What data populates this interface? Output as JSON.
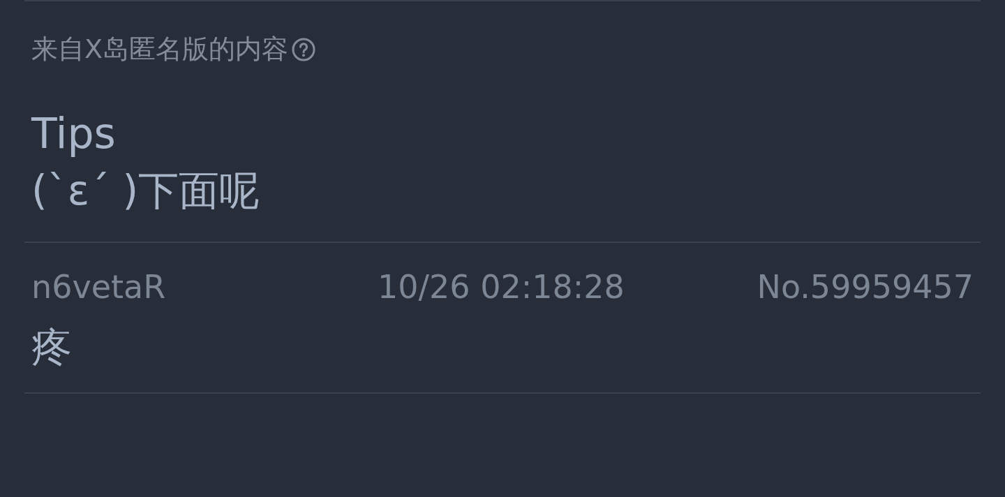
{
  "source_note": {
    "text": "来自X岛匿名版的内容"
  },
  "post": {
    "title": "Tips",
    "body": "(`ε´ )下面呢"
  },
  "replies": [
    {
      "user": "n6vetaR",
      "time": "10/26 02:18:28",
      "number": "No.59959457",
      "body": "疼"
    }
  ]
}
